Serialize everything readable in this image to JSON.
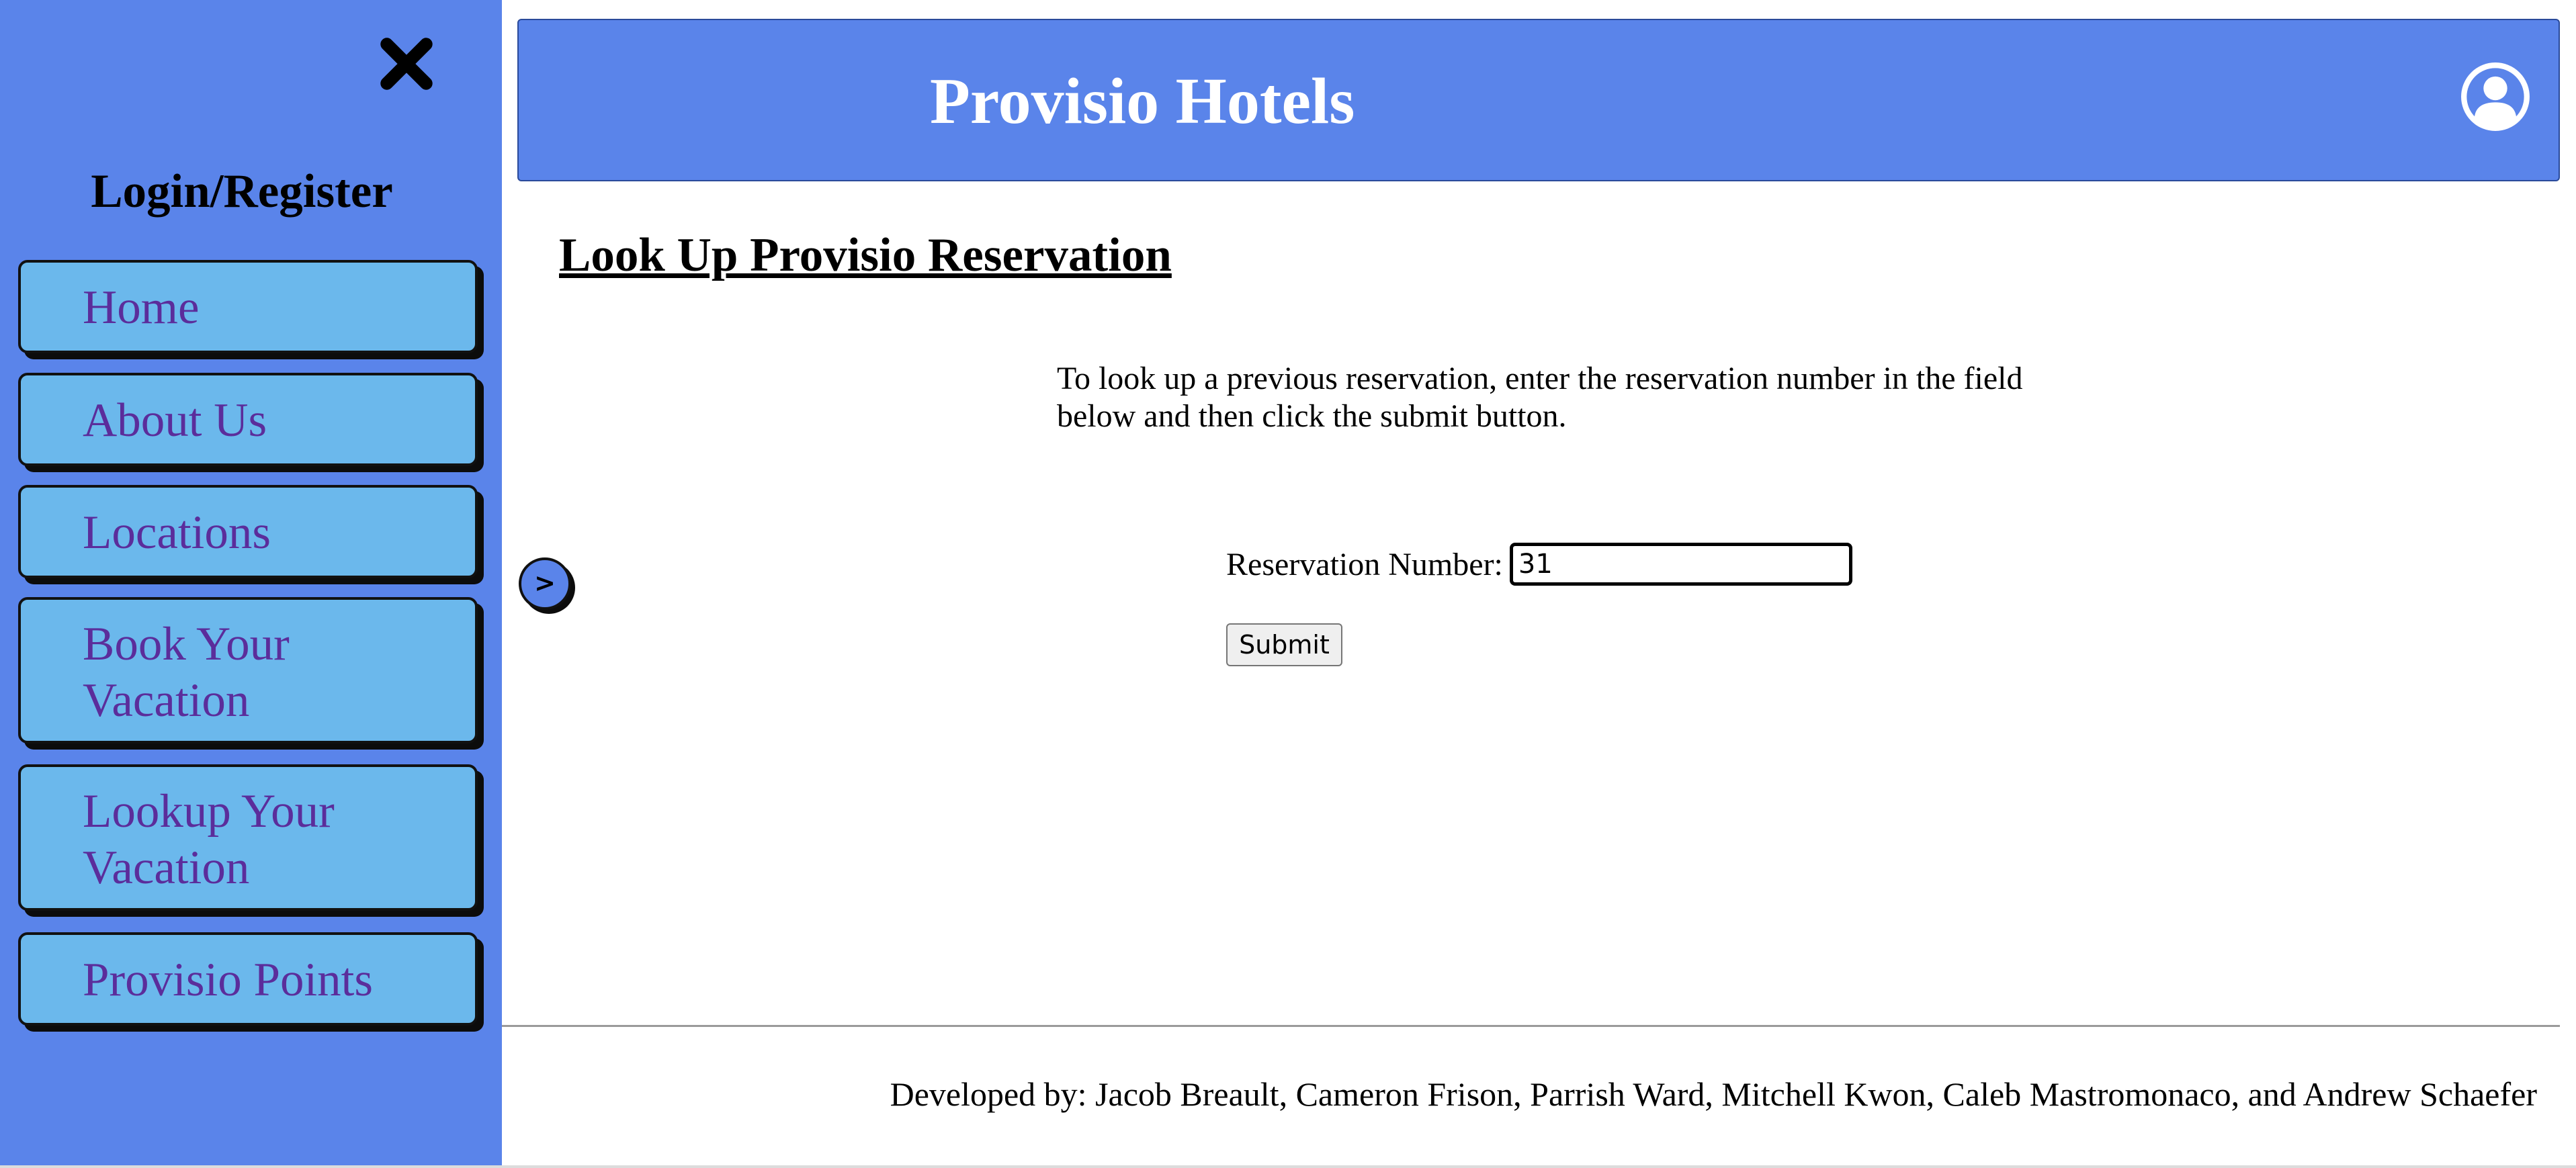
{
  "sidebar": {
    "login_label": "Login/Register",
    "close_icon": "close-x-icon",
    "items": [
      {
        "label": "Home"
      },
      {
        "label": "About Us"
      },
      {
        "label": "Locations"
      },
      {
        "label_lines": [
          "Book Your",
          "Vacation"
        ]
      },
      {
        "label_lines": [
          "Lookup Your",
          "Vacation"
        ]
      },
      {
        "label": "Provisio Points"
      }
    ]
  },
  "header": {
    "title": "Provisio Hotels",
    "user_icon": "user-circle-icon"
  },
  "main": {
    "page_title": "Look Up Provisio Reservation",
    "instructions": "To look up a previous reservation, enter the reservation number in the field below and then click the submit button.",
    "form": {
      "label": "Reservation Number:",
      "value": "31",
      "submit_label": "Submit"
    },
    "sidebar_toggle_label": ">"
  },
  "footer": {
    "credits": "Developed by: Jacob Breault, Cameron Frison, Parrish Ward, Mitchell Kwon, Caleb Mastromonaco, and Andrew Schaefer"
  },
  "colors": {
    "brand_blue": "#5a84ea",
    "nav_button": "#6bb8ec",
    "nav_text": "#5b2d9b"
  }
}
